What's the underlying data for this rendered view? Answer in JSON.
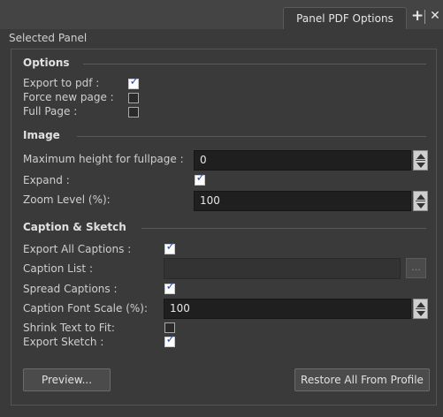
{
  "titlebar": {
    "tab_label": "Panel PDF Options",
    "add_icon": "plus-icon",
    "close_icon": "close-icon"
  },
  "header": {
    "label": "Selected Panel"
  },
  "options": {
    "title": "Options",
    "export_to_pdf": {
      "label": "Export to pdf :",
      "checked": true
    },
    "force_new_page": {
      "label": "Force new page :",
      "checked": false
    },
    "full_page": {
      "label": "Full Page :",
      "checked": false
    }
  },
  "image": {
    "title": "Image",
    "max_height": {
      "label": "Maximum height for fullpage :",
      "value": "0"
    },
    "expand": {
      "label": "Expand :",
      "checked": true
    },
    "zoom": {
      "label": "Zoom Level (%):",
      "value": "100"
    }
  },
  "caption": {
    "title": "Caption & Sketch",
    "export_all": {
      "label": "Export All Captions :",
      "checked": true
    },
    "caption_list": {
      "label": "Caption List :",
      "value": "",
      "button": "..."
    },
    "spread": {
      "label": "Spread Captions :",
      "checked": true
    },
    "font_scale": {
      "label": "Caption Font Scale (%):",
      "value": "100"
    },
    "shrink": {
      "label": "Shrink Text to Fit:",
      "checked": false
    },
    "export_sketch": {
      "label": "Export Sketch :",
      "checked": true
    }
  },
  "buttons": {
    "preview": "Preview...",
    "restore": "Restore All From Profile"
  }
}
